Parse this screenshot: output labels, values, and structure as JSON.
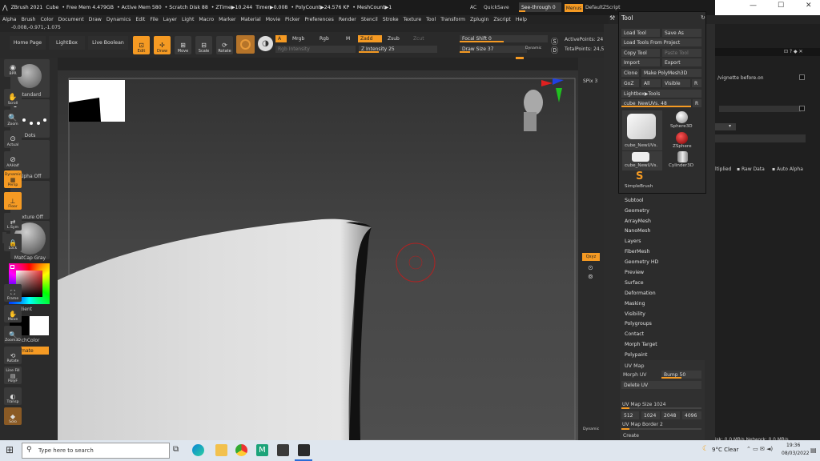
{
  "window": {
    "app_title": "ZBrush 2021",
    "status_items": [
      "Cube",
      "• Free Mem 4.479GB",
      "• Active Mem 580",
      "• Scratch Disk 88",
      "• ZTime▶10.244",
      "Timer▶0.008",
      "• PolyCount▶24.576 KP",
      "• MeshCount▶1"
    ],
    "ac_label": "AC",
    "quicksave": "QuickSave",
    "see_through_label": "See-through",
    "see_through_value": "0",
    "menus_label": "Menus",
    "script_label": "DefaultZScript",
    "controls": {
      "minimize": "—",
      "maximize": "☐",
      "close": "✕"
    }
  },
  "menubar": [
    "Alpha",
    "Brush",
    "Color",
    "Document",
    "Draw",
    "Dynamics",
    "Edit",
    "File",
    "Layer",
    "Light",
    "Macro",
    "Marker",
    "Material",
    "Movie",
    "Picker",
    "Preferences",
    "Render",
    "Stencil",
    "Stroke",
    "Texture",
    "Tool",
    "Transform",
    "Zplugin",
    "Zscript",
    "Help"
  ],
  "coords_text": "-0.008,-0.971,-1.075",
  "shelf": {
    "home_page": "Home Page",
    "lightbox": "LightBox",
    "live_boolean": "Live Boolean",
    "edit": "Edit",
    "draw": "Draw",
    "move": "Move",
    "scale": "Scale",
    "rotate": "Rotate",
    "a_btn": "A",
    "mrgb": "Mrgb",
    "rgb": "Rgb",
    "m": "M",
    "zadd": "Zadd",
    "zsub": "Zsub",
    "zcut": "Zcut",
    "rgb_intensity": "Rgb Intensity",
    "z_intensity_label": "Z Intensity",
    "z_intensity_value": "25",
    "focal_shift_label": "Focal Shift",
    "focal_shift_value": "0",
    "draw_size_label": "Draw Size",
    "draw_size_value": "37",
    "dynamic": "Dynamic",
    "active_points": "ActivePoints: 24",
    "total_points": "TotalPoints: 24,5"
  },
  "left_panel": {
    "brush": "Standard",
    "stroke": "Dots",
    "alpha": "Alpha Off",
    "texture": "Texture Off",
    "material": "MatCap Gray",
    "gradient": "Gradient",
    "switch_color": "SwitchColor",
    "alternate": "Alternate"
  },
  "right_toolbar": {
    "bpr": "BPR",
    "spix_label": "SPix",
    "spix_value": "3",
    "scroll": "Scroll",
    "zoom": "Zoom",
    "actual": "Actual",
    "aahalf": "AAHalf",
    "dynamic": "Dynamic",
    "persp": "Persp",
    "floor": "Floor",
    "local": "L.Sym",
    "lock": "Lock",
    "xyz": "Qxyz",
    "frame": "Frame",
    "move": "Move",
    "zoom3d": "Zoom3D",
    "rotate": "Rotate",
    "linefill": "Line Fill",
    "polyf": "PolyF",
    "transp": "Transp",
    "ghost": "Ghost",
    "solo": "Solo",
    "dynamic2": "Dynamic"
  },
  "tool_palette": {
    "title": "Tool",
    "load_tool": "Load Tool",
    "save_as": "Save As",
    "load_from_project": "Load Tools From Project",
    "copy_tool": "Copy Tool",
    "paste_tool": "Paste Tool",
    "import": "Import",
    "export": "Export",
    "clone": "Clone",
    "make_polymesh": "Make PolyMesh3D",
    "goz": "GoZ",
    "all": "All",
    "visible": "Visible",
    "r": "R",
    "lightbox_tools": "Lightbox▶Tools",
    "current_tool_label": "cube_NewUVs.",
    "current_tool_value": "48",
    "r2": "R",
    "thumbs": [
      "cube_NewUVs.",
      "Sphere3D",
      "ZSphere",
      "cube_NewUVs.",
      "Cylinder3D",
      "SimpleBrush"
    ]
  },
  "tool_menu": [
    "Subtool",
    "Geometry",
    "ArrayMesh",
    "NanoMesh",
    "Layers",
    "FiberMesh",
    "Geometry HD",
    "Preview",
    "Surface",
    "Deformation",
    "Masking",
    "Visibility",
    "Polygroups",
    "Contact",
    "Morph Target",
    "Polypaint"
  ],
  "uv_map": {
    "title": "UV Map",
    "morph_uv": "Morph UV",
    "bump_label": "Bump",
    "bump_value": "50",
    "delete_uv": "Delete UV",
    "size_label": "UV Map Size",
    "size_value": "1024",
    "sizes": [
      "512",
      "1024",
      "2048",
      "4096"
    ],
    "border_label": "UV Map Border",
    "border_value": "2",
    "create": "Create"
  },
  "background_panel": {
    "path": "/vignette before.on",
    "multiplied": "ltiplied",
    "raw_data": "Raw Data",
    "auto_alpha": "Auto Alpha",
    "status": "isk: 0.0 MB/s  Network: 0.0 MB/s"
  },
  "taskbar": {
    "search_placeholder": "Type here to search",
    "weather": "9°C  Clear",
    "time": "19:36",
    "date": "08/03/2022"
  }
}
